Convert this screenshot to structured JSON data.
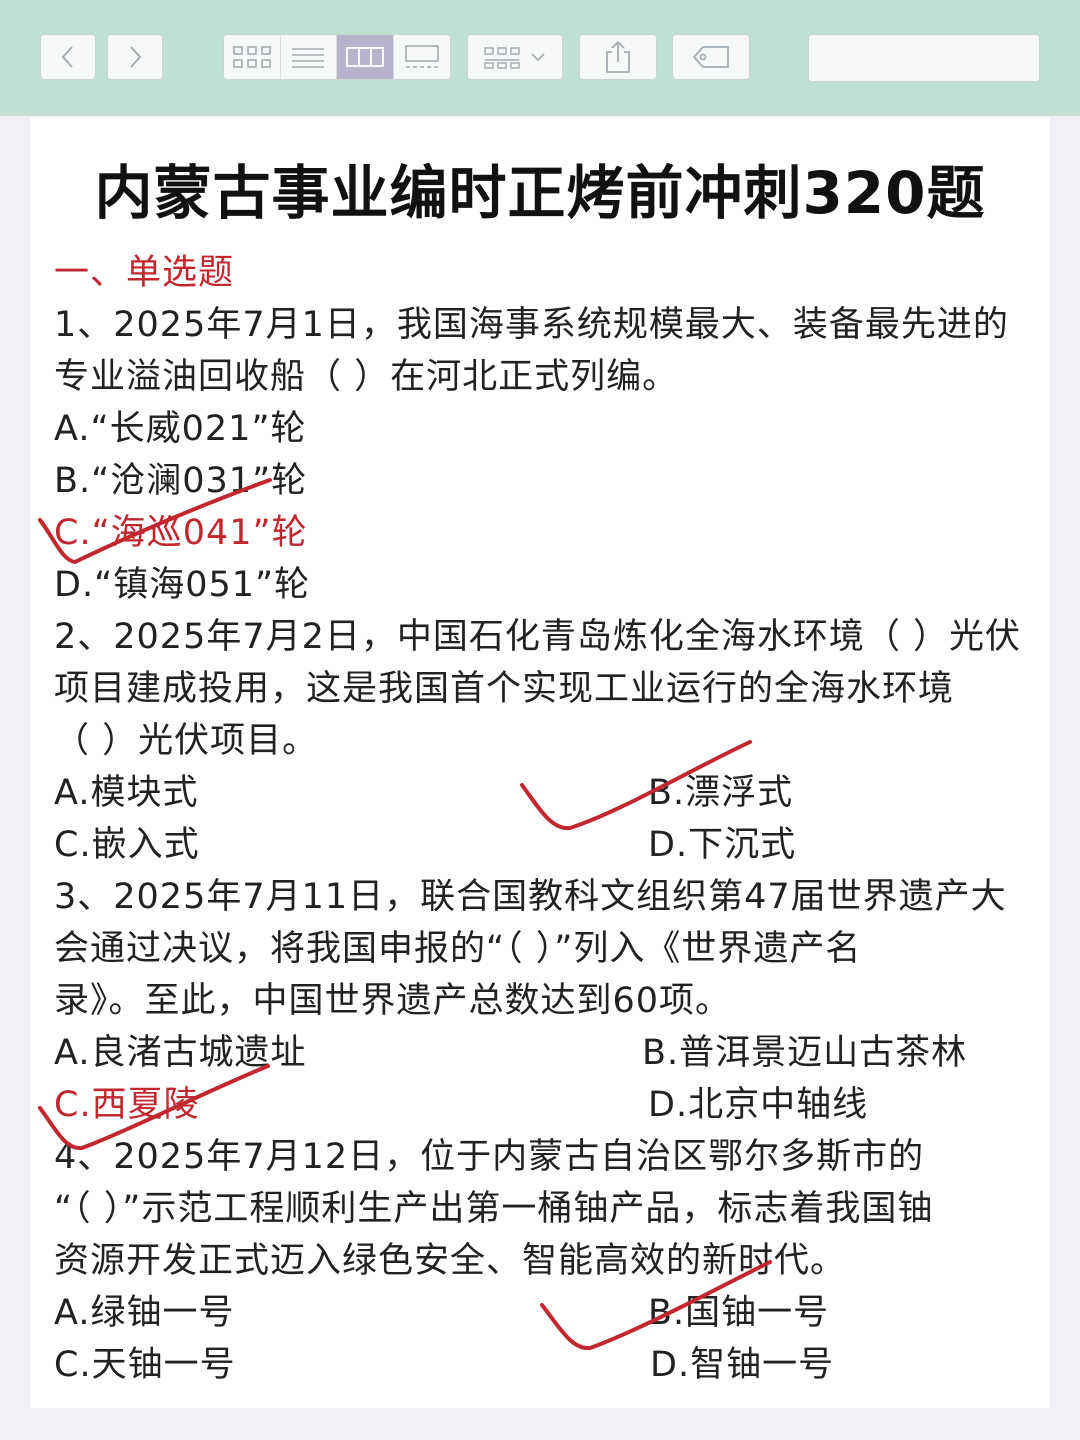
{
  "search": {
    "placeholder": ""
  },
  "title": "内蒙古事业编时正烤前冲刺320题",
  "section": "一、单选题",
  "q1": {
    "l1": "1、2025年7月1日，我国海事系统规模最大、装备最先进的",
    "l2": "专业溢油回收船（ ）在河北正式列编。",
    "a": "A.“长威021”轮",
    "b": "B.“沧澜031”轮",
    "c": "C.“海巡041”轮",
    "d": "D.“镇海051”轮"
  },
  "q2": {
    "l1": "2、2025年7月2日，中国石化青岛炼化全海水环境（ ）光伏",
    "l2": "项目建成投用，这是我国首个实现工业运行的全海水环境",
    "l3": "（ ）光伏项目。",
    "a": "A.模块式",
    "b": "B.漂浮式",
    "c": "C.嵌入式",
    "d": "D.下沉式"
  },
  "q3": {
    "l1": "3、2025年7月11日，联合国教科文组织第47届世界遗产大",
    "l2": "会通过决议，将我国申报的“（ ）”列入《世界遗产名",
    "l3": "录》。至此，中国世界遗产总数达到60项。",
    "a": "A.良渚古城遗址",
    "b": "B.普洱景迈山古茶林",
    "c": "C.西夏陵",
    "d": "D.北京中轴线"
  },
  "q4": {
    "l1": "4、2025年7月12日，位于内蒙古自治区鄂尔多斯市的",
    "l2": "“（ ）”示范工程顺利生产出第一桶铀产品，标志着我国铀",
    "l3": "资源开发正式迈入绿色安全、智能高效的新时代。",
    "a": "A.绿铀一号",
    "b": "B.国铀一号",
    "c": "C.天铀一号",
    "d": "D.智铀一号"
  },
  "colors": {
    "answer": "#c2262e",
    "toolbar": "#bfe0d3"
  }
}
